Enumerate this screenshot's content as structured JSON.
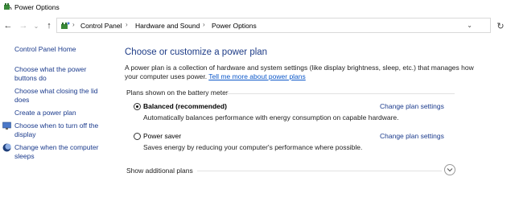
{
  "window": {
    "title": "Power Options"
  },
  "address_bar": {
    "crumbs": [
      "Control Panel",
      "Hardware and Sound",
      "Power Options"
    ]
  },
  "left_pane": {
    "home": "Control Panel Home",
    "links": [
      "Choose what the power buttons do",
      "Choose what closing the lid does",
      "Create a power plan",
      "Choose when to turn off the display",
      "Change when the computer sleeps"
    ]
  },
  "main": {
    "title": "Choose or customize a power plan",
    "intro": "A power plan is a collection of hardware and system settings (like display brightness, sleep, etc.) that manages how your computer uses power.",
    "intro_link": "Tell me more about power plans",
    "group_label": "Plans shown on the battery meter",
    "plans": [
      {
        "name": "Balanced (recommended)",
        "description": "Automatically balances performance with energy consumption on capable hardware.",
        "change_label": "Change plan settings",
        "selected": true
      },
      {
        "name": "Power saver",
        "description": "Saves energy by reducing your computer's performance where possible.",
        "change_label": "Change plan settings",
        "selected": false
      }
    ],
    "show_additional": "Show additional plans"
  },
  "colors": {
    "link": "#1a3a8c",
    "title": "#1e3c87",
    "inline_link": "#0b57c9"
  }
}
